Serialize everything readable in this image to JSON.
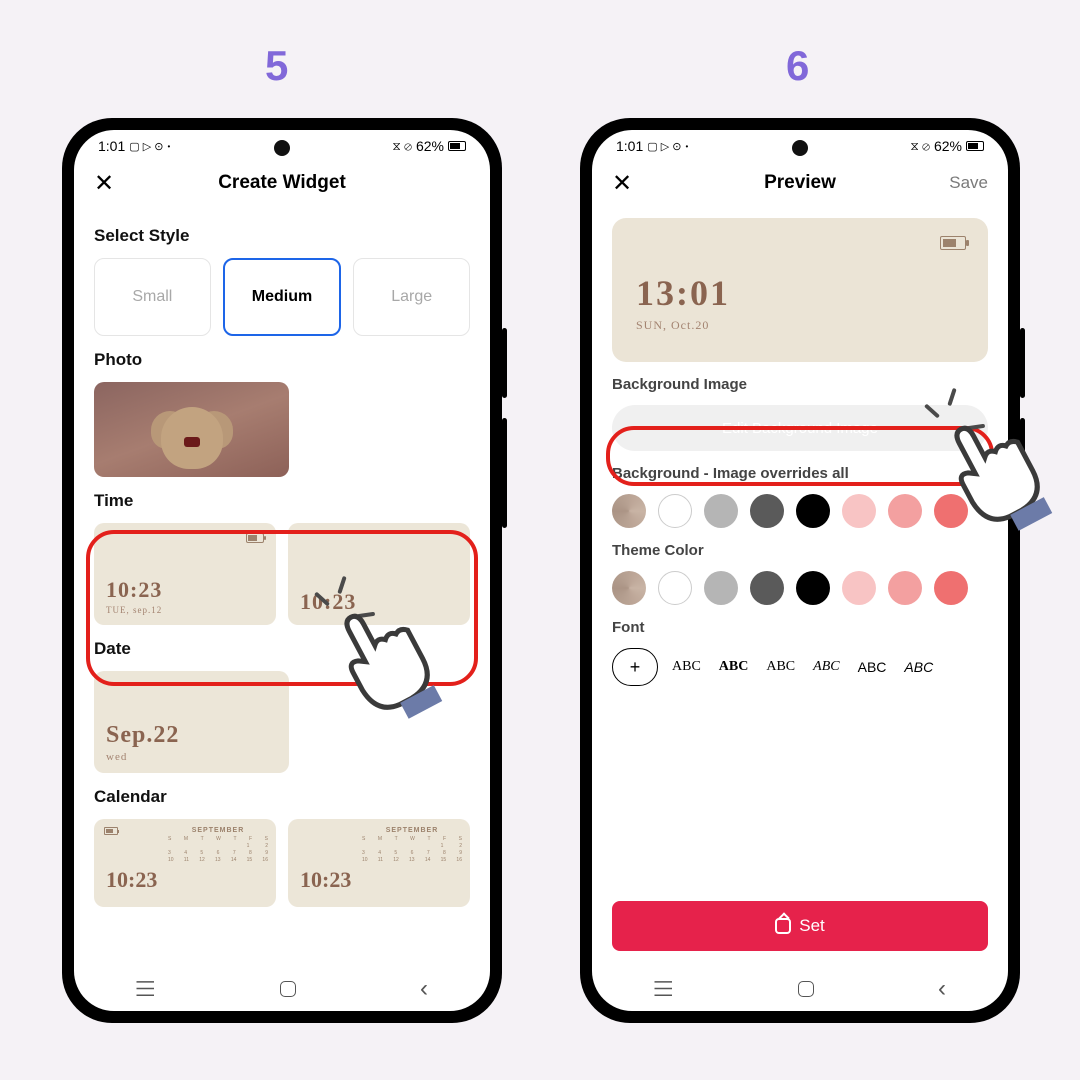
{
  "steps": {
    "left": "5",
    "right": "6"
  },
  "status": {
    "time": "1:01",
    "icons_left": "▶ ▷ ⊙ •",
    "icons_right": "⊘",
    "wifi": "⋮",
    "battery": "62%"
  },
  "screen5": {
    "title": "Create Widget",
    "select_style": "Select Style",
    "sizes": {
      "small": "Small",
      "medium": "Medium",
      "large": "Large"
    },
    "photo_label": "Photo",
    "time_label": "Time",
    "time_widgets": [
      {
        "time": "10:23",
        "date": "TUE, sep.12"
      },
      {
        "time": "10:23",
        "date": ""
      }
    ],
    "date_label": "Date",
    "date_widget": {
      "time": "Sep.22",
      "date": "wed"
    },
    "calendar_label": "Calendar",
    "cal_month": "SEPTEMBER",
    "cal_time": "10:23"
  },
  "screen6": {
    "title": "Preview",
    "save": "Save",
    "preview": {
      "time": "13:01",
      "date": "SUN, Oct.20"
    },
    "bg_image_label": "Background Image",
    "edit_bg": "Edit Background Image",
    "bg_override_label": "Background - Image overrides all",
    "theme_label": "Theme Color",
    "font_label": "Font",
    "font_samples": [
      "ABC",
      "ABC",
      "ABC",
      "ABC",
      "ABC",
      "ABC"
    ],
    "set": "Set",
    "colors": [
      "#ece6d8",
      "#ffffff",
      "#b5b5b5",
      "#5a5a5a",
      "#000000",
      "#f8c4c4",
      "#f3a0a0",
      "#ef7070"
    ]
  },
  "nav": {
    "recent": "|||",
    "home": "▢",
    "back": "‹"
  }
}
